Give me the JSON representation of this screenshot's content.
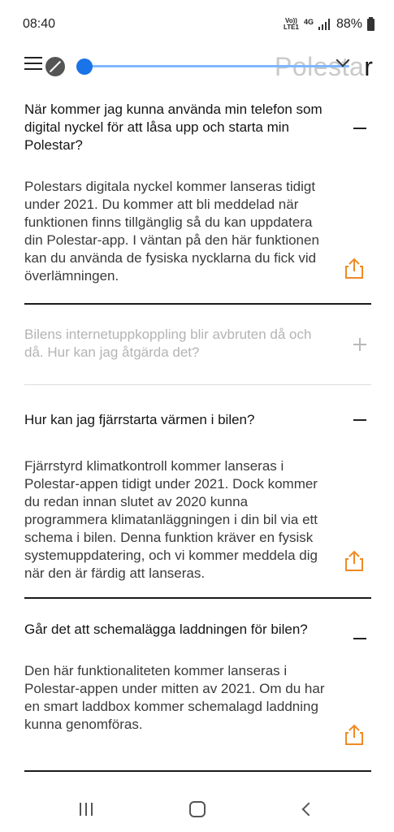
{
  "status_bar": {
    "time": "08:40",
    "volte": "Vo))",
    "lte": "LTE1",
    "network": "4G",
    "battery": "88%"
  },
  "header": {
    "brand_faded": "Polesta",
    "brand_dark": "r"
  },
  "faq": [
    {
      "question": "När kommer jag kunna använda min telefon som digital nyckel för att låsa upp och starta min Polestar?",
      "answer": "Polestars digitala nyckel kommer lanseras tidigt under 2021. Du kommer att bli meddelad när funktionen finns tillgänglig så du kan uppdatera din Polestar-app. I väntan på den här funktionen kan du använda de fysiska nycklarna du fick vid överlämningen.",
      "expanded": true
    },
    {
      "question": "Bilens internetuppkoppling blir avbruten då och då. Hur kan jag åtgärda det?",
      "answer": "",
      "expanded": false
    },
    {
      "question": "Hur kan jag fjärrstarta värmen i bilen?",
      "answer": "Fjärrstyrd klimatkontroll kommer lanseras i Polestar-appen tidigt under 2021. Dock kommer du redan innan slutet av 2020 kunna programmera klimatanläggningen i din bil via ett schema i bilen. Denna funktion kräver en fysisk systemuppdatering, och vi kommer meddela dig när den är färdig att lanseras.",
      "expanded": true
    },
    {
      "question": "Går det att schemalägga laddningen för bilen?",
      "answer": "Den här funktionaliteten kommer lanseras i Polestar-appen under mitten av 2021. Om du har en smart laddbox kommer schemalagd laddning kunna genomföras.",
      "expanded": true
    }
  ],
  "colors": {
    "accent_orange": "#f08a24",
    "slider_blue": "#1a73e8",
    "text": "#141414",
    "collapsed_text": "#b4b4b4"
  }
}
